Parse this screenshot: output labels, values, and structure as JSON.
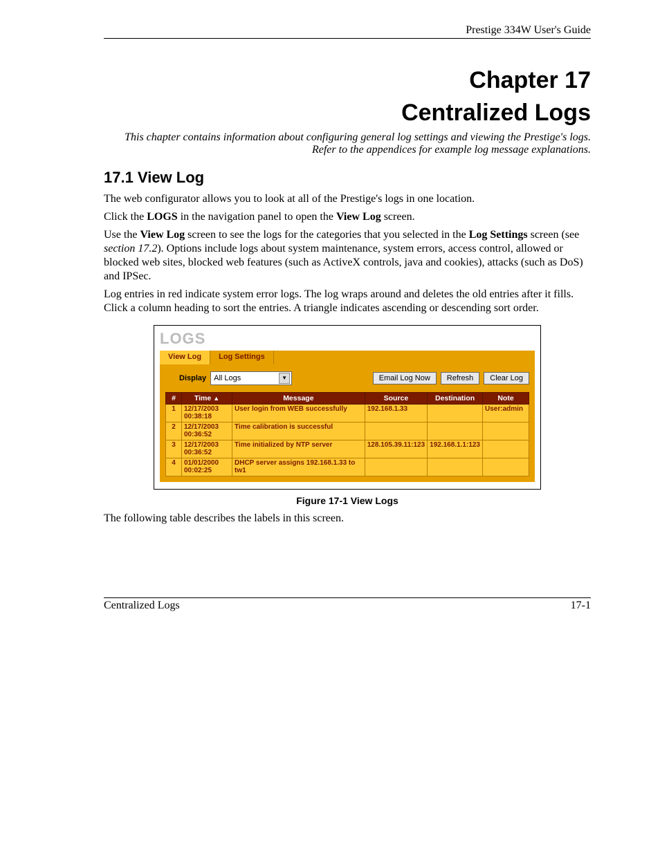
{
  "header": {
    "guide_title": "Prestige 334W User's Guide"
  },
  "chapter": {
    "line1": "Chapter 17",
    "line2": "Centralized Logs",
    "intro": "This chapter contains information about configuring general log settings and viewing the Prestige's logs. Refer to the appendices for example log message explanations."
  },
  "section": {
    "heading": "17.1  View Log",
    "p1": "The web configurator allows you to look at all of the Prestige's logs in one location.",
    "p2_a": "Click the ",
    "p2_b": "LOGS",
    "p2_c": " in the navigation panel to open the ",
    "p2_d": "View Log",
    "p2_e": " screen.",
    "p3_a": "Use the ",
    "p3_b": "View Log",
    "p3_c": " screen to see the logs for the categories that you selected in the ",
    "p3_d": "Log Settings",
    "p3_e": " screen (see ",
    "p3_f": "section 17.2",
    "p3_g": "). Options include logs about system maintenance, system errors, access control, allowed or blocked web sites, blocked web features (such as ActiveX controls, java and cookies), attacks (such as DoS) and IPSec.",
    "p4": "Log entries in red indicate system error logs. The log wraps around and deletes the old entries after it fills. Click a column heading to sort the entries. A triangle indicates ascending or descending sort order."
  },
  "figure": {
    "panel_title": "LOGS",
    "tabs": {
      "view": "View Log",
      "settings": "Log Settings"
    },
    "controls": {
      "display_label": "Display",
      "display_value": "All Logs",
      "btn_email": "Email Log Now",
      "btn_refresh": "Refresh",
      "btn_clear": "Clear Log"
    },
    "columns": {
      "n": "#",
      "time": "Time",
      "msg": "Message",
      "src": "Source",
      "dst": "Destination",
      "note": "Note"
    },
    "sort_arrow": "▲",
    "rows": [
      {
        "n": "1",
        "time": "12/17/2003 00:38:18",
        "msg": "User login from WEB successfully",
        "src": "192.168.1.33",
        "dst": "",
        "note": "User:admin"
      },
      {
        "n": "2",
        "time": "12/17/2003 00:36:52",
        "msg": "Time calibration is successful",
        "src": "",
        "dst": "",
        "note": ""
      },
      {
        "n": "3",
        "time": "12/17/2003 00:36:52",
        "msg": "Time initialized by NTP server",
        "src": "128.105.39.11:123",
        "dst": "192.168.1.1:123",
        "note": ""
      },
      {
        "n": "4",
        "time": "01/01/2000 00:02:25",
        "msg": "DHCP server assigns 192.168.1.33 to tw1",
        "src": "",
        "dst": "",
        "note": ""
      }
    ],
    "caption": "Figure 17-1 View Logs"
  },
  "after_figure": "The following table describes the labels in this screen.",
  "footer": {
    "left": "Centralized Logs",
    "right": "17-1"
  }
}
